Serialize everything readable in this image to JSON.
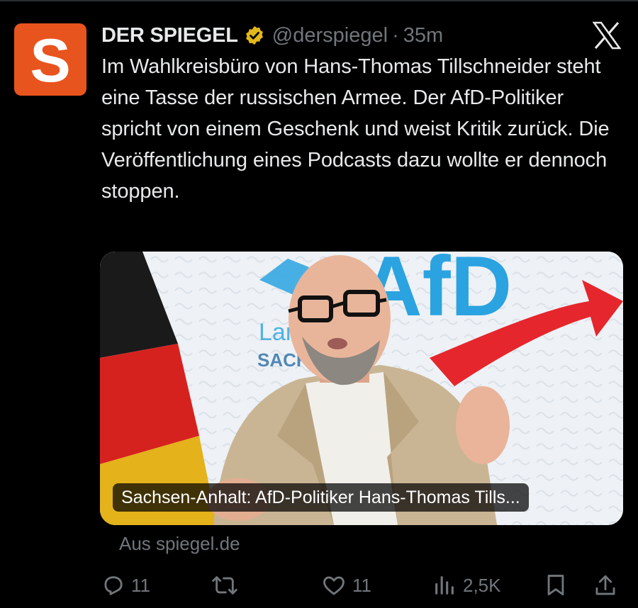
{
  "tweet": {
    "author_name": "DER SPIEGEL",
    "handle": "@derspiegel",
    "separator": "·",
    "time": "35m",
    "avatar_letter": "S",
    "text": "Im Wahlkreisbüro von Hans-Thomas Tillschneider steht eine Tasse der russischen Armee. Der AfD-Politiker spricht von einem Geschenk und weist Kritik zurück. Die Veröffentlichung eines Podcasts dazu wollte er dennoch stoppen."
  },
  "card": {
    "caption": "Sachsen-Anhalt: AfD-Politiker Hans-Thomas Tills...",
    "source": "Aus spiegel.de",
    "photo_text": {
      "logo": "AfD",
      "landesverband_1": "Lan",
      "landesverband_2": "SACHS"
    }
  },
  "actions": {
    "replies": "11",
    "reposts": "",
    "likes": "11",
    "views": "2,5K"
  },
  "colors": {
    "background": "#000000",
    "text": "#e7e9ea",
    "muted": "#71767b",
    "avatar": "#e8541e",
    "verified_badge": "#e2b719",
    "afd_blue": "#2aa3e0",
    "afd_red": "#e5262c"
  },
  "icons": [
    "spiegel-logo-icon",
    "verified-badge-icon",
    "x-logo-icon",
    "reply-icon",
    "repost-icon",
    "like-icon",
    "views-icon",
    "bookmark-icon",
    "share-icon"
  ]
}
